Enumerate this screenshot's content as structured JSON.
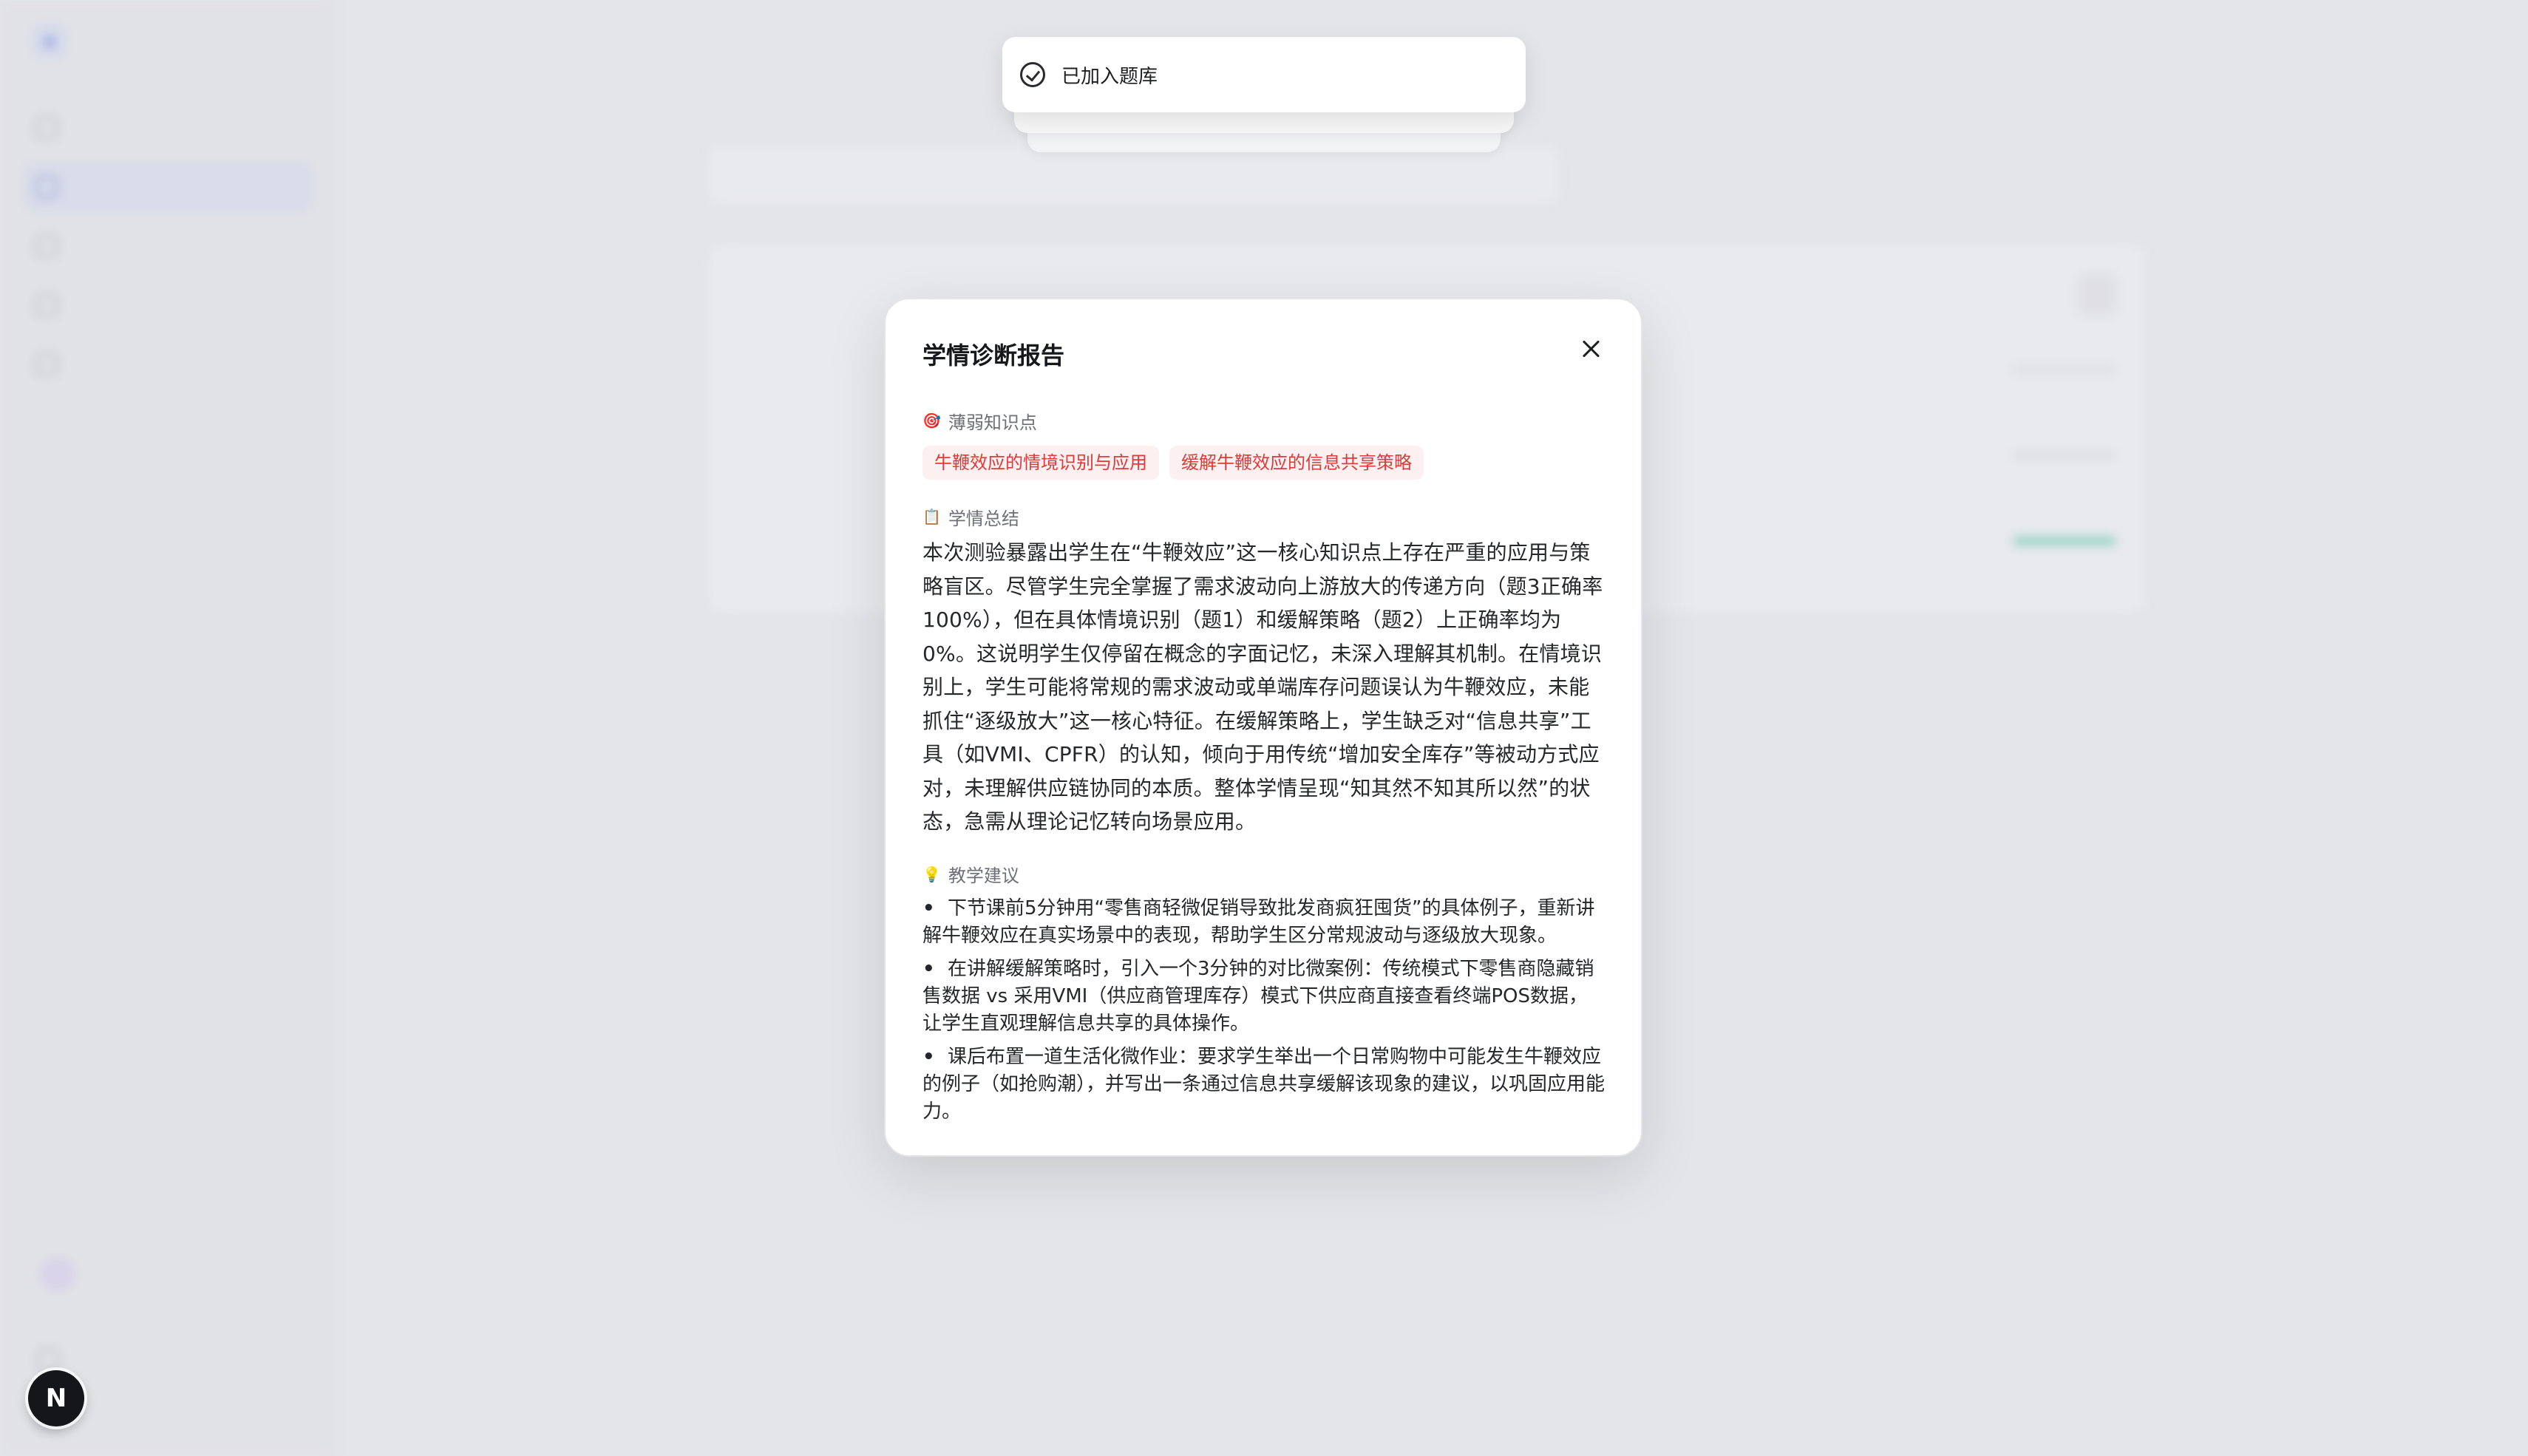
{
  "toast": {
    "message": "已加入题库",
    "icon": "check-circle-icon"
  },
  "modal": {
    "title": "学情诊断报告",
    "weak_points": {
      "icon": "🎯",
      "label": "薄弱知识点",
      "tags": [
        "牛鞭效应的情境识别与应用",
        "缓解牛鞭效应的信息共享策略"
      ]
    },
    "summary": {
      "icon": "📋",
      "label": "学情总结",
      "text": "本次测验暴露出学生在“牛鞭效应”这一核心知识点上存在严重的应用与策略盲区。尽管学生完全掌握了需求波动向上游放大的传递方向（题3正确率100%），但在具体情境识别（题1）和缓解策略（题2）上正确率均为0%。这说明学生仅停留在概念的字面记忆，未深入理解其机制。在情境识别上，学生可能将常规的需求波动或单端库存问题误认为牛鞭效应，未能抓住“逐级放大”这一核心特征。在缓解策略上，学生缺乏对“信息共享”工具（如VMI、CPFR）的认知，倾向于用传统“增加安全库存”等被动方式应对，未理解供应链协同的本质。整体学情呈现“知其然不知其所以然”的状态，急需从理论记忆转向场景应用。"
    },
    "suggestions": {
      "icon": "💡",
      "label": "教学建议",
      "items": [
        "下节课前5分钟用“零售商轻微促销导致批发商疯狂囤货”的具体例子，重新讲解牛鞭效应在真实场景中的表现，帮助学生区分常规波动与逐级放大现象。",
        "在讲解缓解策略时，引入一个3分钟的对比微案例：传统模式下零售商隐藏销售数据 vs 采用VMI（供应商管理库存）模式下供应商直接查看终端POS数据，让学生直观理解信息共享的具体操作。",
        "课后布置一道生活化微作业：要求学生举出一个日常购物中可能发生牛鞭效应的例子（如抢购潮），并写出一条通过信息共享缓解该现象的建议，以巩固应用能力。"
      ]
    }
  },
  "fab": {
    "label": "N"
  },
  "colors": {
    "accent": "#5b6ed1",
    "tag_text": "#de3a3a",
    "tag_bg": "#fdf0f0",
    "progress_fill": "#57c4a0"
  }
}
